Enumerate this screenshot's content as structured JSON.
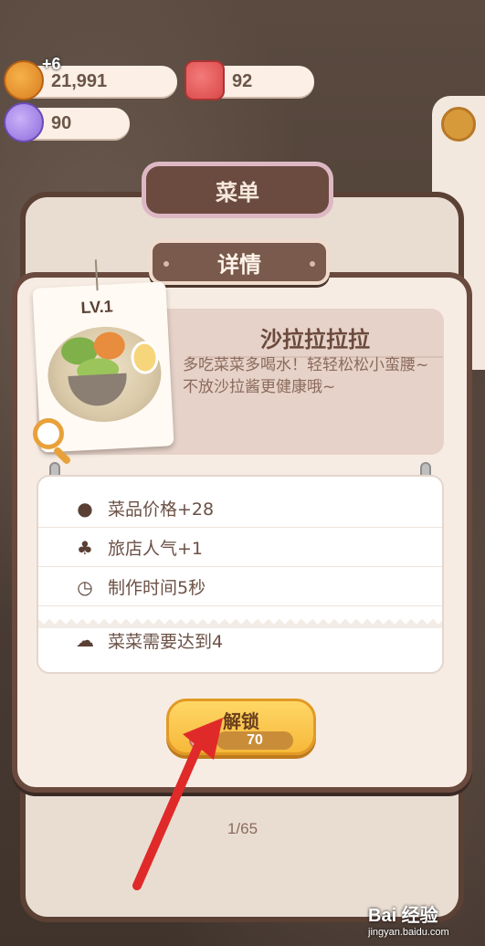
{
  "currency": {
    "cookies": {
      "value": "21,991",
      "bonus": "+6",
      "icon": "cookie-icon"
    },
    "tickets": {
      "value": "92",
      "icon": "ticket-icon"
    },
    "gems": {
      "value": "90",
      "icon": "gem-icon"
    }
  },
  "menu": {
    "title": "菜单"
  },
  "detail": {
    "title": "详情",
    "level": "LV.1",
    "dish_name": "沙拉拉拉拉",
    "description": "多吃菜菜多喝水！轻轻松松小蛮腰~不放沙拉酱更健康哦~",
    "stats": [
      {
        "icon": "cookie-icon",
        "text": "菜品价格+28"
      },
      {
        "icon": "popularity-icon",
        "text": "旅店人气+1"
      },
      {
        "icon": "clock-icon",
        "text": "制作时间5秒"
      }
    ],
    "requirement": {
      "icon": "vegetable-icon",
      "text": "菜菜需要达到4"
    },
    "unlock": {
      "label": "解锁",
      "cost": "70"
    }
  },
  "pager": {
    "text": "1/65"
  },
  "watermark": {
    "text": "Bai 经验",
    "sub": "jingyan.baidu.com"
  },
  "colors": {
    "accent": "#f6b83a",
    "frame": "#6a4a3e",
    "arrow": "#e02a2a"
  }
}
